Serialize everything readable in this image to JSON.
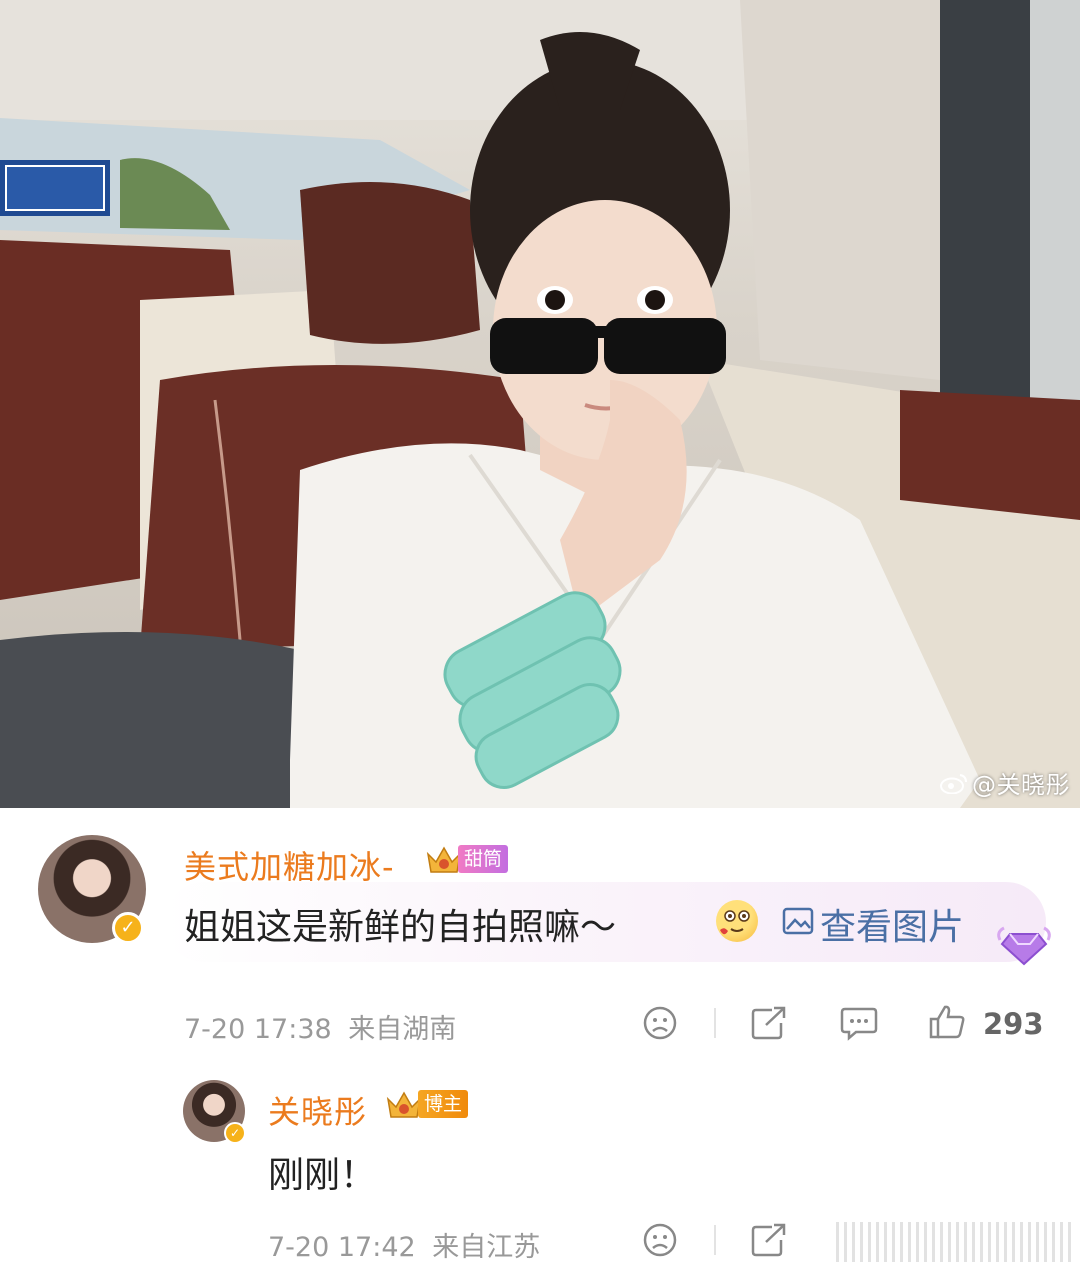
{
  "watermark": {
    "platform_icon": "weibo-logo-icon",
    "text": "@关晓彤"
  },
  "comment": {
    "username": "美式加糖加冰-",
    "badge_label": "甜筒",
    "text": "姐姐这是新鲜的自拍照嘛～",
    "emoji": "drooling-face-emoji",
    "view_image_label": "查看图片",
    "time": "7-20 17:38",
    "location": "来自湖南",
    "like_count": "293"
  },
  "reply": {
    "username": "关晓彤",
    "badge_label": "博主",
    "text": "刚刚！",
    "time": "7-20 17:42",
    "location": "来自江苏"
  },
  "colors": {
    "username": "#eb7b1e",
    "link": "#4a6fa5",
    "meta": "#999999",
    "verified": "#f6b21a"
  }
}
